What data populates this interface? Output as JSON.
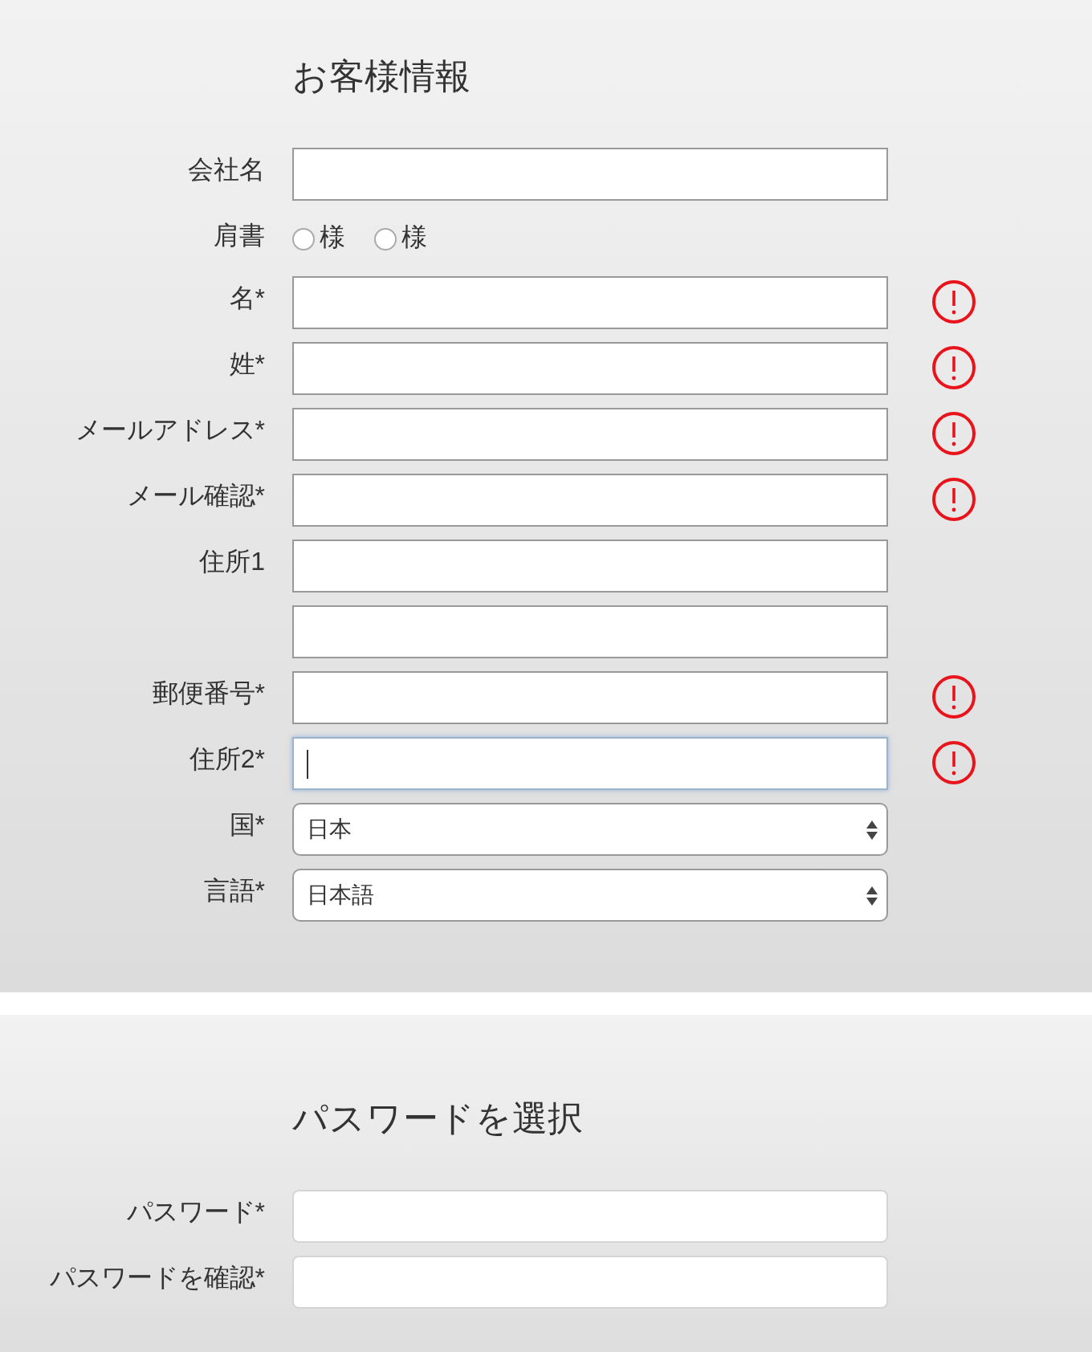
{
  "sections": [
    {
      "title": "お客様情報",
      "rows": [
        {
          "kind": "text",
          "label": "会社名",
          "error": false,
          "focused": false
        },
        {
          "kind": "radio",
          "label": "肩書",
          "options": [
            {
              "label": "様",
              "selected": false
            },
            {
              "label": "様",
              "selected": false
            }
          ]
        },
        {
          "kind": "text",
          "label": "名*",
          "error": true,
          "focused": false
        },
        {
          "kind": "text",
          "label": "姓*",
          "error": true,
          "focused": false
        },
        {
          "kind": "text",
          "label": "メールアドレス*",
          "error": true,
          "focused": false
        },
        {
          "kind": "text",
          "label": "メール確認*",
          "error": true,
          "focused": false
        },
        {
          "kind": "text",
          "label": "住所1",
          "error": false,
          "focused": false
        },
        {
          "kind": "text",
          "error": false,
          "focused": false
        },
        {
          "kind": "text",
          "label": "郵便番号*",
          "error": true,
          "focused": false
        },
        {
          "kind": "text",
          "label": "住所2*",
          "error": true,
          "focused": true
        },
        {
          "kind": "select",
          "label": "国*",
          "value": "日本"
        },
        {
          "kind": "select",
          "label": "言語*",
          "value": "日本語"
        }
      ]
    },
    {
      "title": "パスワードを選択",
      "rows": [
        {
          "kind": "password",
          "label": "パスワード*",
          "error": false,
          "focused": false
        },
        {
          "kind": "password",
          "label": "パスワードを確認*",
          "error": false,
          "focused": false
        }
      ]
    }
  ]
}
